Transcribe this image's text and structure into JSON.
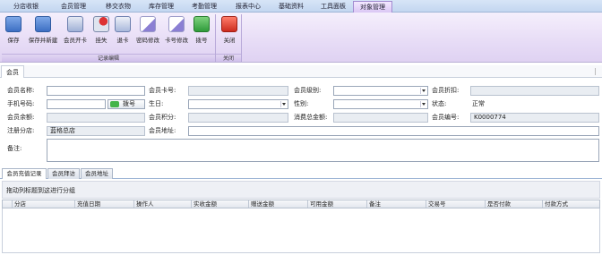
{
  "top_tabs": [
    "分店收银",
    "会员管理",
    "移交衣物",
    "库存管理",
    "考勤管理",
    "报表中心",
    "基础资料",
    "工具面板",
    "对象管理"
  ],
  "active_top_tab": "对象管理",
  "ribbon": {
    "buttons": [
      {
        "label": "保存",
        "icon": "save-icon",
        "color": "#4a7fd0"
      },
      {
        "label": "保存并新建",
        "icon": "save-new-icon",
        "color": "#4a7fd0"
      },
      {
        "label": "会员开卡",
        "icon": "open-card-icon",
        "color": "#7a8fbf"
      },
      {
        "label": "挂失",
        "icon": "report-loss-icon",
        "color": "#b04040"
      },
      {
        "label": "退卡",
        "icon": "return-card-icon",
        "color": "#6c84b5"
      },
      {
        "label": "密码修改",
        "icon": "edit-password-icon",
        "color": "#7e6fc2"
      },
      {
        "label": "卡号修改",
        "icon": "edit-cardno-icon",
        "color": "#7e6fc2"
      },
      {
        "label": "拨号",
        "icon": "phone-icon",
        "color": "#3fae4a"
      },
      {
        "label": "关闭",
        "icon": "close-icon",
        "color": "#d83a2e"
      }
    ],
    "groups": [
      "记录编辑",
      "关闭"
    ]
  },
  "panel_title": "会员",
  "form": {
    "member_name_label": "会员名称:",
    "member_name_value": "",
    "card_no_label": "会员卡号:",
    "card_no_value": "",
    "level_label": "会员级别:",
    "level_value": "",
    "discount_label": "会员折扣:",
    "discount_value": "",
    "phone_label": "手机号码:",
    "phone_value": "",
    "dial_label": "拨号",
    "birthday_label": "生日:",
    "birthday_value": "",
    "gender_label": "性别:",
    "gender_value": "",
    "status_label": "状态:",
    "status_value": "正常",
    "balance_label": "会员余额:",
    "balance_value": "",
    "points_label": "会员积分:",
    "points_value": "",
    "spent_label": "消费总金额:",
    "spent_value": "",
    "member_no_label": "会员编号:",
    "member_no_value": "K0000774",
    "branch_label": "注册分店:",
    "branch_value": "蓝格总店",
    "address_label": "会员地址:",
    "address_value": "",
    "remark_label": "备注:",
    "remark_value": ""
  },
  "sub_tabs": [
    "会员充值记录",
    "会员拜访",
    "会员地址"
  ],
  "group_hint": "拖动列标题到这进行分组",
  "grid_columns": [
    "分店",
    "充值日期",
    "操作人",
    "实收金额",
    "赠送金额",
    "可用金额",
    "备注",
    "交易号",
    "是否付款",
    "付款方式"
  ]
}
